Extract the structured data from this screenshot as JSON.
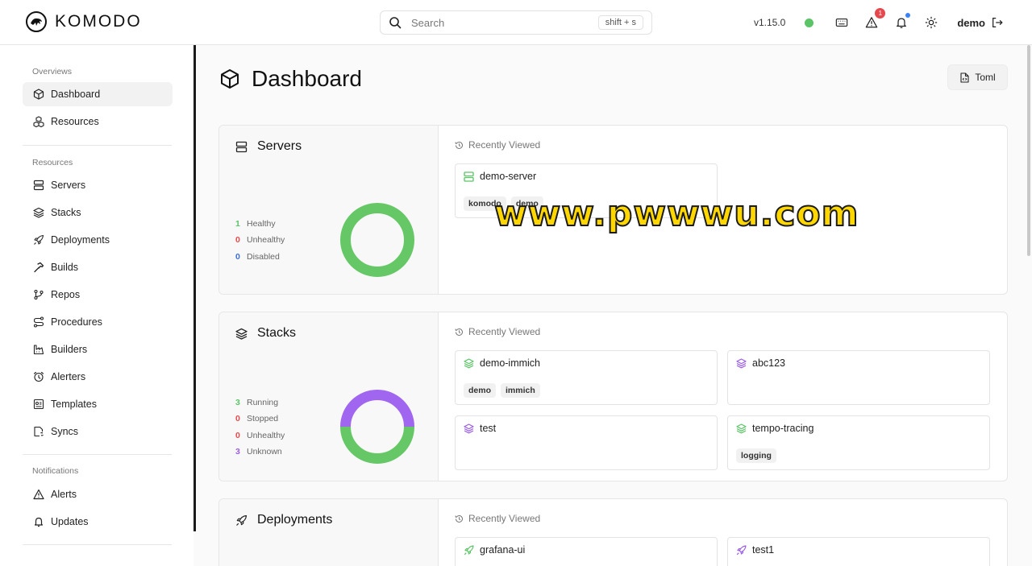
{
  "header": {
    "brand": "KOMODO",
    "search_placeholder": "Search",
    "search_shortcut": "shift + s",
    "version": "v1.15.0",
    "alert_count": "1",
    "user": "demo"
  },
  "sidebar": {
    "sections": [
      {
        "label": "Overviews",
        "items": [
          "Dashboard",
          "Resources"
        ]
      },
      {
        "label": "Resources",
        "items": [
          "Servers",
          "Stacks",
          "Deployments",
          "Builds",
          "Repos",
          "Procedures",
          "Builders",
          "Alerters",
          "Templates",
          "Syncs"
        ]
      },
      {
        "label": "Notifications",
        "items": [
          "Alerts",
          "Updates"
        ]
      }
    ],
    "active": "Dashboard"
  },
  "page": {
    "title": "Dashboard",
    "toml_button": "Toml"
  },
  "cards": {
    "servers": {
      "title": "Servers",
      "recent_label": "Recently Viewed",
      "stats": [
        {
          "count": "1",
          "label": "Healthy",
          "color": "#5ac466"
        },
        {
          "count": "0",
          "label": "Unhealthy",
          "color": "#e5484d"
        },
        {
          "count": "0",
          "label": "Disabled",
          "color": "#3b6fd1"
        }
      ],
      "donut": [
        {
          "value": 1,
          "color": "#66c766"
        }
      ],
      "items": [
        {
          "name": "demo-server",
          "tags": [
            "komodo",
            "demo"
          ],
          "color": "#5ac466"
        }
      ]
    },
    "stacks": {
      "title": "Stacks",
      "recent_label": "Recently Viewed",
      "stats": [
        {
          "count": "3",
          "label": "Running",
          "color": "#5ac466"
        },
        {
          "count": "0",
          "label": "Stopped",
          "color": "#e5484d"
        },
        {
          "count": "0",
          "label": "Unhealthy",
          "color": "#e5484d"
        },
        {
          "count": "3",
          "label": "Unknown",
          "color": "#9b5de5"
        }
      ],
      "donut": [
        {
          "value": 3,
          "color": "#66c766"
        },
        {
          "value": 3,
          "color": "#a066f0"
        }
      ],
      "items": [
        {
          "name": "demo-immich",
          "tags": [
            "demo",
            "immich"
          ],
          "color": "#5ac466"
        },
        {
          "name": "abc123",
          "tags": [],
          "color": "#9b5de5"
        },
        {
          "name": "test",
          "tags": [],
          "color": "#9b5de5"
        },
        {
          "name": "tempo-tracing",
          "tags": [
            "logging"
          ],
          "color": "#5ac466"
        }
      ]
    },
    "deployments": {
      "title": "Deployments",
      "recent_label": "Recently Viewed",
      "items": [
        {
          "name": "grafana-ui",
          "tags": [],
          "color": "#5ac466"
        },
        {
          "name": "test1",
          "tags": [],
          "color": "#9b5de5"
        }
      ]
    }
  },
  "watermark": "www.pwwwu.com"
}
